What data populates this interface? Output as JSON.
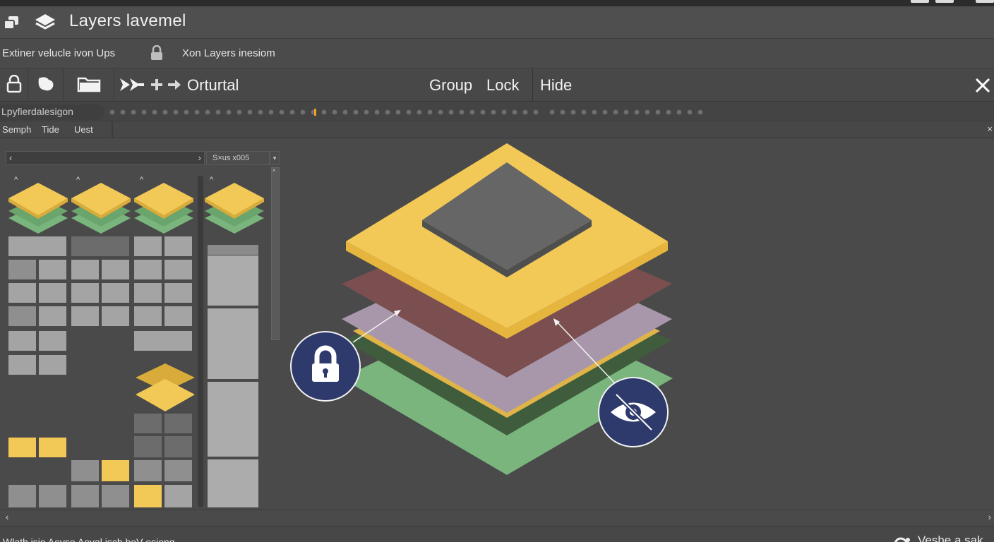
{
  "window": {
    "title": "Layers lavemel",
    "accent_color": "#f2c957",
    "icons": [
      "windows-icon",
      "layers-icon"
    ]
  },
  "infobar": {
    "text_left": "Extiner velucle ivon  Ups",
    "text_right": "Xon Layers inesiom",
    "icon": "lock-icon"
  },
  "toolbar": {
    "tools": [
      "lock-icon",
      "paint-icon",
      "folder-icon",
      "forward-icon",
      "plus-icon",
      "arrow-right-icon"
    ],
    "label": "Orturtal",
    "group_label": "Group",
    "lock_label": "Lock",
    "hide_label": "Hide",
    "close_icon": "close-icon"
  },
  "timeline": {
    "label": "Lpyfierdalesigon",
    "marker_color": "#f0a020"
  },
  "tabs": {
    "items": [
      "Semph",
      "Tide",
      "Uest"
    ],
    "close_label": "×"
  },
  "leftpanel": {
    "nav_prev": "‹",
    "nav_next": "›",
    "size_label": "S×us x005",
    "dropdown": "▾",
    "caret": "^",
    "scroll_up": "^"
  },
  "canvas": {
    "layer_colors": [
      "#7ab57d",
      "#3f5d3c",
      "#f2c957",
      "#a897ab",
      "#7b4f50",
      "#f2c957",
      "#666666"
    ],
    "lock_badge_icon": "lock-icon",
    "hide_badge_icon": "eye-slash-icon",
    "badge_color": "#2e3a6b"
  },
  "hscroll": {
    "left": "‹",
    "right": "›"
  },
  "statusbar": {
    "text": "Wlath isio Aeyso  Aoyal isch  boV esiong",
    "right_text": "Veshe a sak",
    "right_icon": "camera-icon"
  }
}
